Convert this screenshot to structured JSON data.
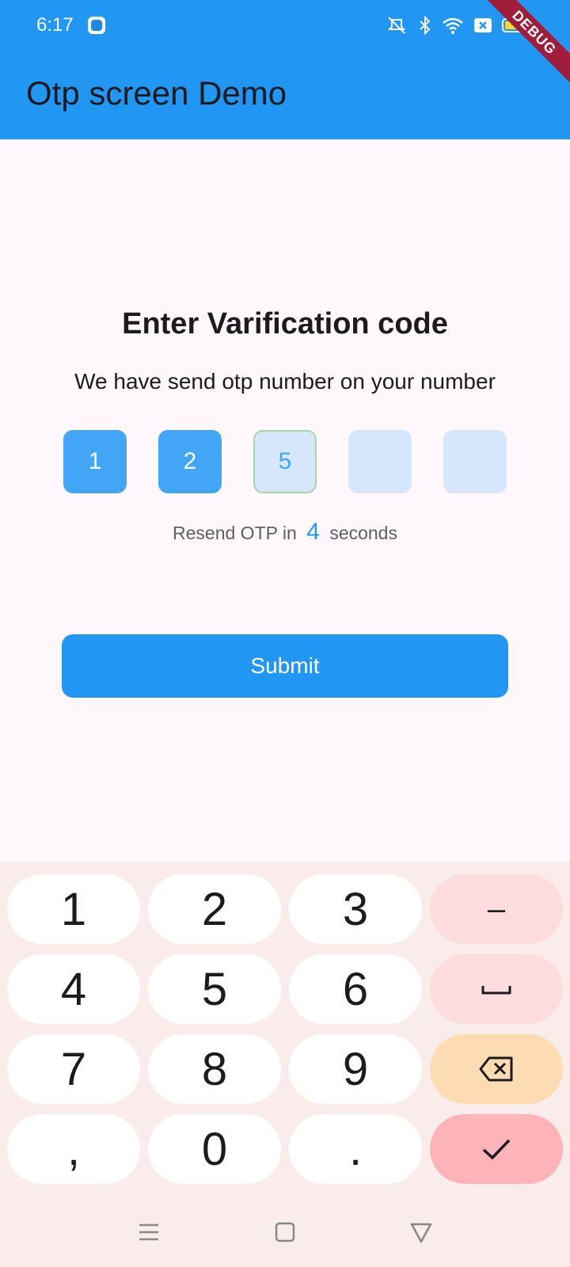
{
  "status_bar": {
    "time": "6:17",
    "icons": [
      "app-icon",
      "mute-icon",
      "bluetooth-icon",
      "wifi-icon",
      "sim-off-icon",
      "battery-icon"
    ]
  },
  "debug_banner": "DEBUG",
  "app_bar": {
    "title": "Otp screen Demo"
  },
  "content": {
    "heading": "Enter Varification code",
    "subheading": "We have send otp number on your number",
    "otp_digits": [
      "1",
      "2",
      "5",
      "",
      ""
    ],
    "resend_prefix": "Resend OTP in",
    "resend_count": "4",
    "resend_suffix": "seconds",
    "submit_label": "Submit"
  },
  "keyboard": {
    "rows": [
      [
        "1",
        "2",
        "3",
        "–"
      ],
      [
        "4",
        "5",
        "6",
        "␣"
      ],
      [
        "7",
        "8",
        "9",
        "backspace"
      ],
      [
        ",",
        "0",
        ".",
        "done"
      ]
    ]
  },
  "nav_bar": {
    "icons": [
      "menu-icon",
      "home-icon",
      "back-icon"
    ]
  },
  "colors": {
    "primary": "#2196f3",
    "otp_filled": "#42a5f5",
    "otp_empty": "#d6e6fb",
    "keyboard_bg": "#fbecec",
    "enter_key": "#fdb4b8",
    "backspace_key": "#fddcb4"
  }
}
